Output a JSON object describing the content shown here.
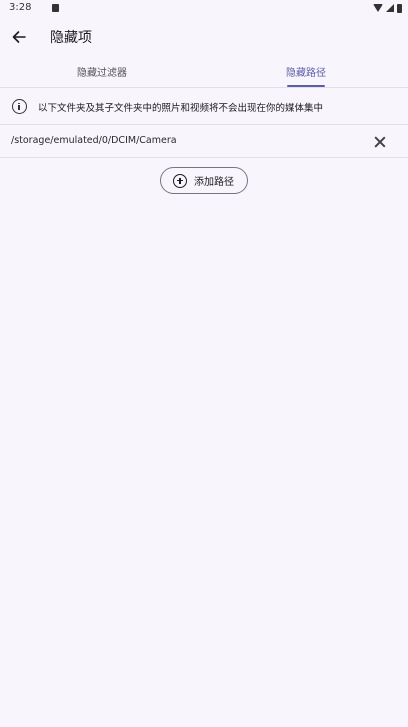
{
  "status_bar": {
    "time": "3:28"
  },
  "app_bar": {
    "title": "隐藏项"
  },
  "tabs": [
    {
      "label": "隐藏过滤器",
      "selected": false
    },
    {
      "label": "隐藏路径",
      "selected": true
    }
  ],
  "info": {
    "text": "以下文件夹及其子文件夹中的照片和视频将不会出现在你的媒体集中"
  },
  "paths": [
    {
      "path": "/storage/emulated/0/DCIM/Camera"
    }
  ],
  "add_button": {
    "label": "添加路径"
  },
  "colors": {
    "background": "#f8f5fc",
    "accent": "#5b5fa8",
    "divider": "#e2dfe6"
  }
}
